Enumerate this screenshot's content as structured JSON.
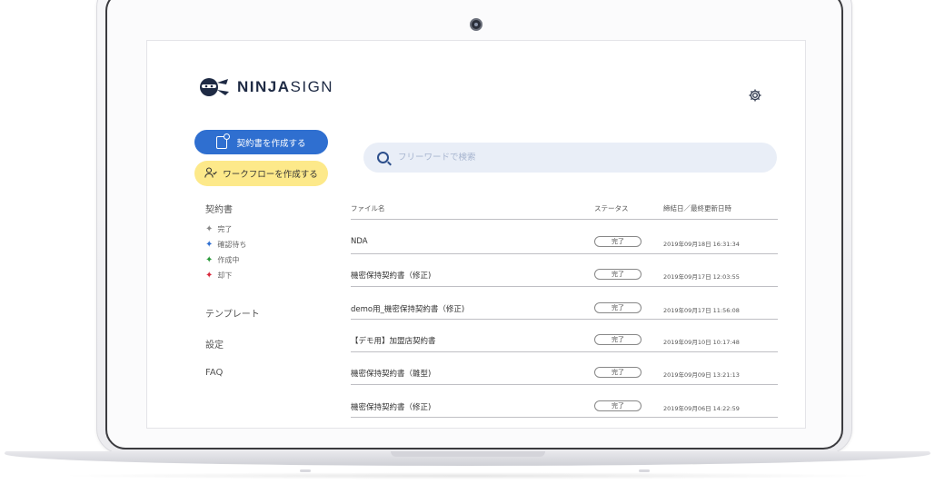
{
  "app": {
    "logo_bold": "NINJA",
    "logo_light": "SIGN"
  },
  "sidebar": {
    "create_contract_label": "契約書を作成する",
    "create_workflow_label": "ワークフローを作成する",
    "contracts_heading": "契約書",
    "statuses": [
      {
        "label": "完了",
        "color": "#888888"
      },
      {
        "label": "確認待ち",
        "color": "#2f6fd0"
      },
      {
        "label": "作成中",
        "color": "#2a9a3a"
      },
      {
        "label": "却下",
        "color": "#d8283c"
      }
    ],
    "templates_label": "テンプレート",
    "settings_label": "設定",
    "faq_label": "FAQ"
  },
  "search": {
    "placeholder": "フリーワードで検索"
  },
  "table": {
    "headers": {
      "file_name": "ファイル名",
      "status": "ステータス",
      "date": "締結日／最終更新日時"
    },
    "rows": [
      {
        "name": "NDA",
        "status": "完了",
        "date": "2019年09月18日 16:31:34"
      },
      {
        "name": "機密保持契約書（修正)",
        "status": "完了",
        "date": "2019年09月17日 12:03:55"
      },
      {
        "name": "demo用_機密保持契約書（修正)",
        "status": "完了",
        "date": "2019年09月17日 11:56:08"
      },
      {
        "name": "【デモ用】加盟店契約書",
        "status": "完了",
        "date": "2019年09月10日 10:17:48"
      },
      {
        "name": "機密保持契約書（雛型)",
        "status": "完了",
        "date": "2019年09月09日 13:21:13"
      },
      {
        "name": "機密保持契約書（修正)",
        "status": "完了",
        "date": "2019年09月06日 14:22:59"
      }
    ]
  },
  "colors": {
    "primary": "#2f6fd0",
    "workflow": "#fde98a",
    "search_bg": "#e9eef7",
    "logo_text": "#1e2a44"
  }
}
